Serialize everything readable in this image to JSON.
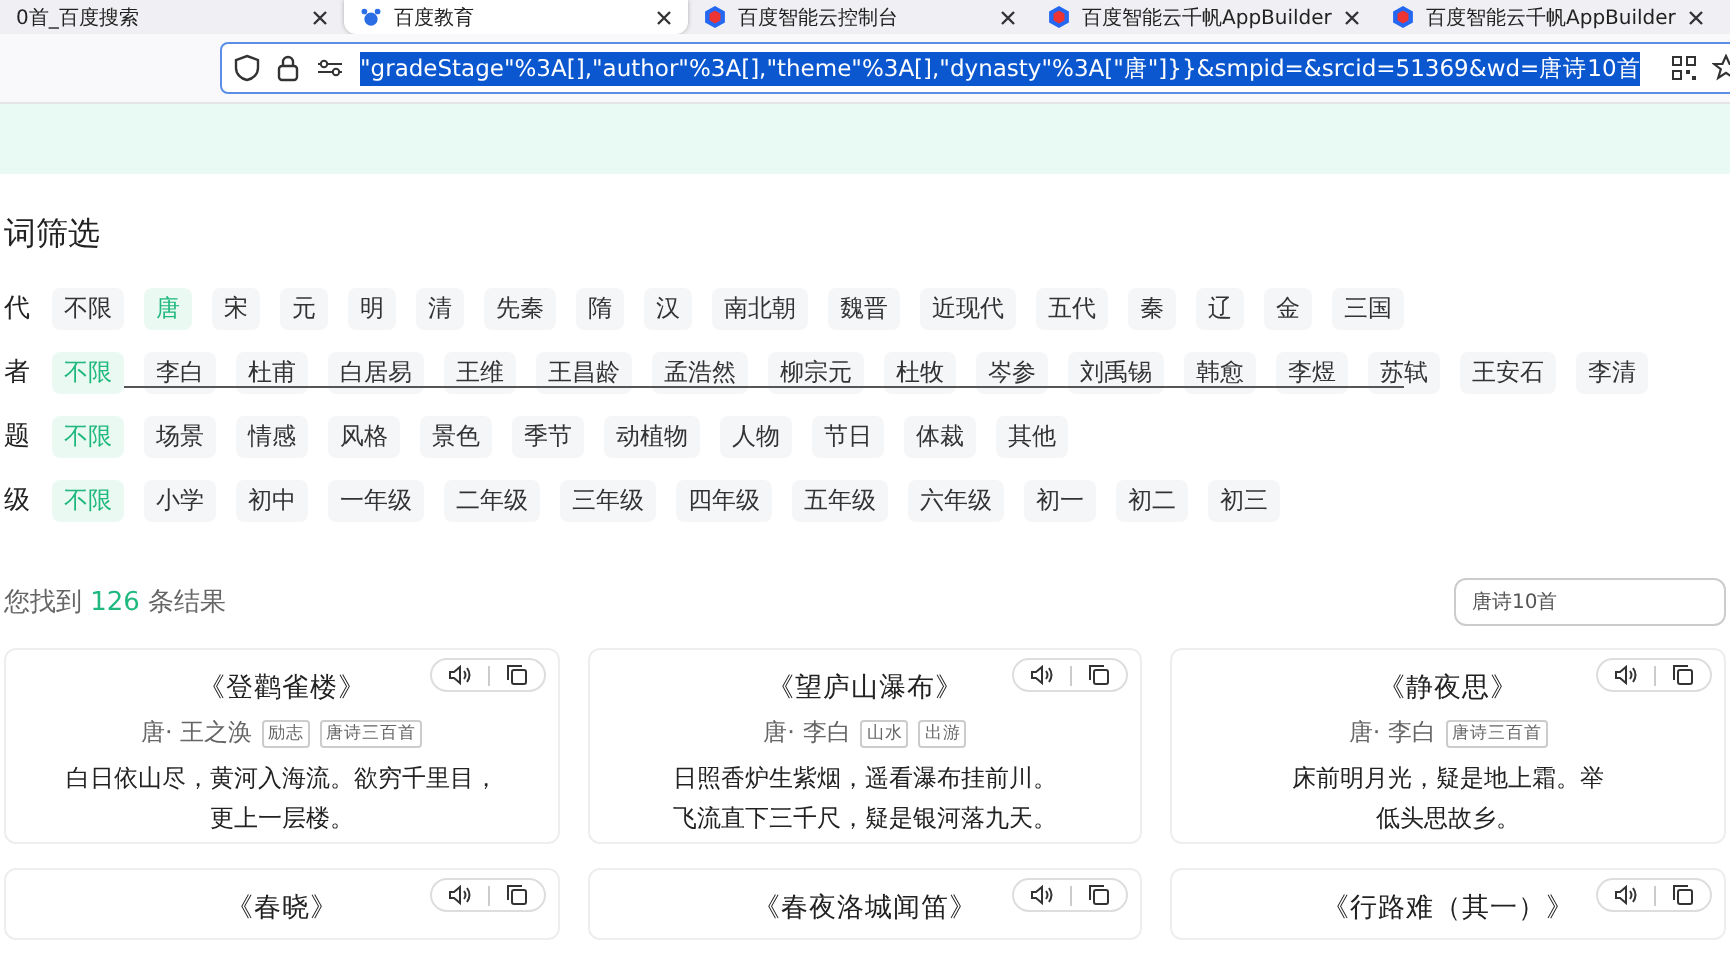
{
  "browser": {
    "tabs": [
      {
        "title": "0首_百度搜索",
        "selected": false
      },
      {
        "title": "百度教育",
        "selected": true
      },
      {
        "title": "百度智能云控制台",
        "selected": false
      },
      {
        "title": "百度智能云千帆AppBuilder",
        "selected": false
      },
      {
        "title": "百度智能云千帆AppBuilder",
        "selected": false
      }
    ],
    "address": "\"gradeStage\"%3A[],\"author\"%3A[],\"theme\"%3A[],\"dynasty\"%3A[\"唐\"]}}&smpid=&srcid=51369&wd=唐诗10首"
  },
  "filter": {
    "heading": "词筛选",
    "rows": [
      {
        "label": "代",
        "options": [
          {
            "text": "不限",
            "selected": false
          },
          {
            "text": "唐",
            "selected": true
          },
          {
            "text": "宋",
            "selected": false
          },
          {
            "text": "元",
            "selected": false
          },
          {
            "text": "明",
            "selected": false
          },
          {
            "text": "清",
            "selected": false
          },
          {
            "text": "先秦",
            "selected": false
          },
          {
            "text": "隋",
            "selected": false
          },
          {
            "text": "汉",
            "selected": false
          },
          {
            "text": "南北朝",
            "selected": false
          },
          {
            "text": "魏晋",
            "selected": false
          },
          {
            "text": "近现代",
            "selected": false
          },
          {
            "text": "五代",
            "selected": false
          },
          {
            "text": "秦",
            "selected": false
          },
          {
            "text": "辽",
            "selected": false
          },
          {
            "text": "金",
            "selected": false
          },
          {
            "text": "三国",
            "selected": false
          }
        ]
      },
      {
        "label": "者",
        "options": [
          {
            "text": "不限",
            "selected": true
          },
          {
            "text": "李白",
            "selected": false
          },
          {
            "text": "杜甫",
            "selected": false
          },
          {
            "text": "白居易",
            "selected": false
          },
          {
            "text": "王维",
            "selected": false
          },
          {
            "text": "王昌龄",
            "selected": false
          },
          {
            "text": "孟浩然",
            "selected": false
          },
          {
            "text": "柳宗元",
            "selected": false
          },
          {
            "text": "杜牧",
            "selected": false
          },
          {
            "text": "岑参",
            "selected": false
          },
          {
            "text": "刘禹锡",
            "selected": false
          },
          {
            "text": "韩愈",
            "selected": false
          },
          {
            "text": "李煜",
            "selected": false
          },
          {
            "text": "苏轼",
            "selected": false
          },
          {
            "text": "王安石",
            "selected": false
          },
          {
            "text": "李清",
            "selected": false
          }
        ]
      },
      {
        "label": "题",
        "options": [
          {
            "text": "不限",
            "selected": true
          },
          {
            "text": "场景",
            "selected": false
          },
          {
            "text": "情感",
            "selected": false
          },
          {
            "text": "风格",
            "selected": false
          },
          {
            "text": "景色",
            "selected": false
          },
          {
            "text": "季节",
            "selected": false
          },
          {
            "text": "动植物",
            "selected": false
          },
          {
            "text": "人物",
            "selected": false
          },
          {
            "text": "节日",
            "selected": false
          },
          {
            "text": "体裁",
            "selected": false
          },
          {
            "text": "其他",
            "selected": false
          }
        ]
      },
      {
        "label": "级",
        "options": [
          {
            "text": "不限",
            "selected": true
          },
          {
            "text": "小学",
            "selected": false
          },
          {
            "text": "初中",
            "selected": false
          },
          {
            "text": "一年级",
            "selected": false
          },
          {
            "text": "二年级",
            "selected": false
          },
          {
            "text": "三年级",
            "selected": false
          },
          {
            "text": "四年级",
            "selected": false
          },
          {
            "text": "五年级",
            "selected": false
          },
          {
            "text": "六年级",
            "selected": false
          },
          {
            "text": "初一",
            "selected": false
          },
          {
            "text": "初二",
            "selected": false
          },
          {
            "text": "初三",
            "selected": false
          }
        ]
      }
    ]
  },
  "results": {
    "prefix": "您找到",
    "count": "126",
    "suffix": "条结果",
    "search_value": "唐诗10首"
  },
  "poems": [
    {
      "title": "《登鹳雀楼》",
      "author": "唐· 王之涣",
      "tags": [
        "励志",
        "唐诗三百首"
      ],
      "lines": [
        "白日依山尽，黄河入海流。欲穷千里目，",
        "更上一层楼。"
      ]
    },
    {
      "title": "《望庐山瀑布》",
      "author": "唐· 李白",
      "tags": [
        "山水",
        "出游"
      ],
      "lines": [
        "日照香炉生紫烟，遥看瀑布挂前川。",
        "飞流直下三千尺，疑是银河落九天。"
      ]
    },
    {
      "title": "《静夜思》",
      "author": "唐· 李白",
      "tags": [
        "唐诗三百首"
      ],
      "lines": [
        "床前明月光，疑是地上霜。举",
        "低头思故乡。"
      ]
    },
    {
      "title": "《春晓》"
    },
    {
      "title": "《春夜洛城闻笛》"
    },
    {
      "title": "《行路难（其一）》"
    }
  ]
}
